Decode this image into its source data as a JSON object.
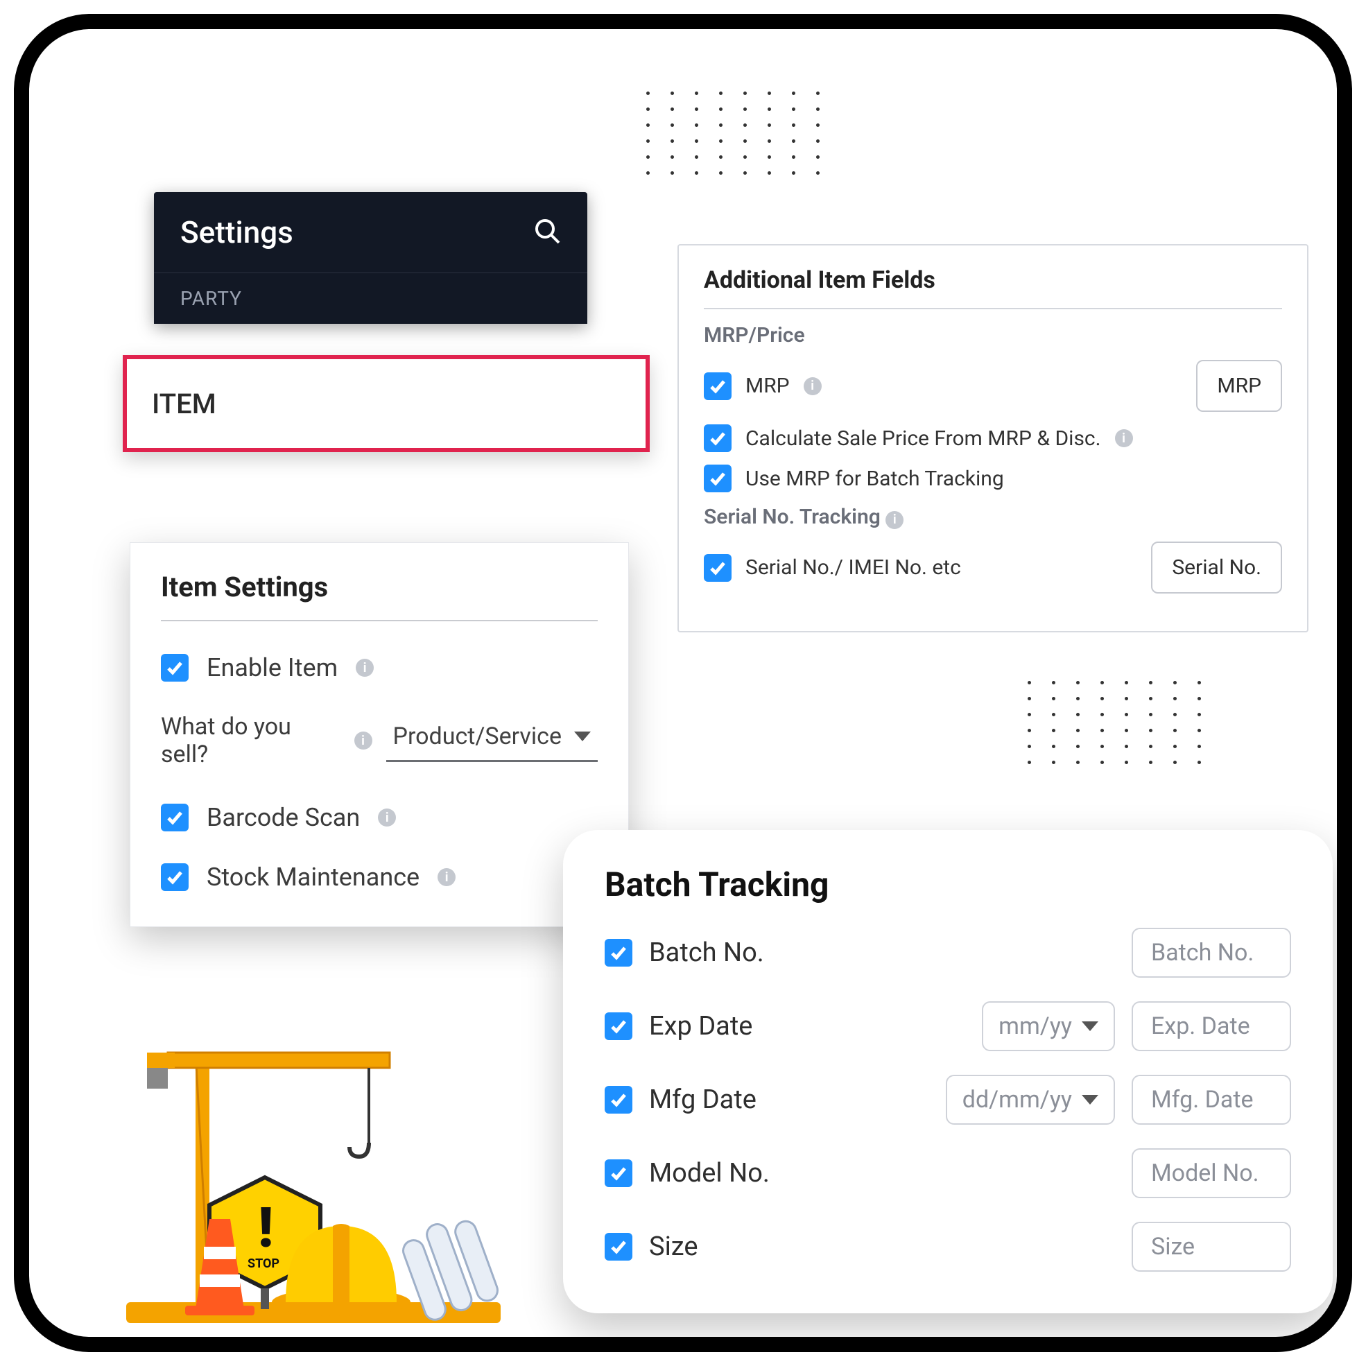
{
  "settings": {
    "title": "Settings",
    "party": "PARTY",
    "item": "ITEM"
  },
  "itemSettings": {
    "title": "Item Settings",
    "enable": "Enable Item",
    "sellQ": "What do you sell?",
    "sellVal": "Product/Service",
    "barcode": "Barcode Scan",
    "stock": "Stock Maintenance"
  },
  "addl": {
    "title": "Additional Item Fields",
    "mrpHdr": "MRP/Price",
    "mrp": "MRP",
    "mrpIn": "MRP",
    "calc": "Calculate Sale Price From MRP & Disc.",
    "useMrp": "Use MRP for Batch Tracking",
    "serialHdr": "Serial No. Tracking",
    "serial": "Serial No./ IMEI No. etc",
    "serialIn": "Serial No."
  },
  "batch": {
    "title": "Batch Tracking",
    "r": [
      {
        "l": "Batch No.",
        "i": "Batch No."
      },
      {
        "l": "Exp Date",
        "fmt": "mm/yy",
        "i": "Exp. Date"
      },
      {
        "l": "Mfg Date",
        "fmt": "dd/mm/yy",
        "i": "Mfg. Date"
      },
      {
        "l": "Model No.",
        "i": "Model No."
      },
      {
        "l": "Size",
        "i": "Size"
      }
    ]
  }
}
